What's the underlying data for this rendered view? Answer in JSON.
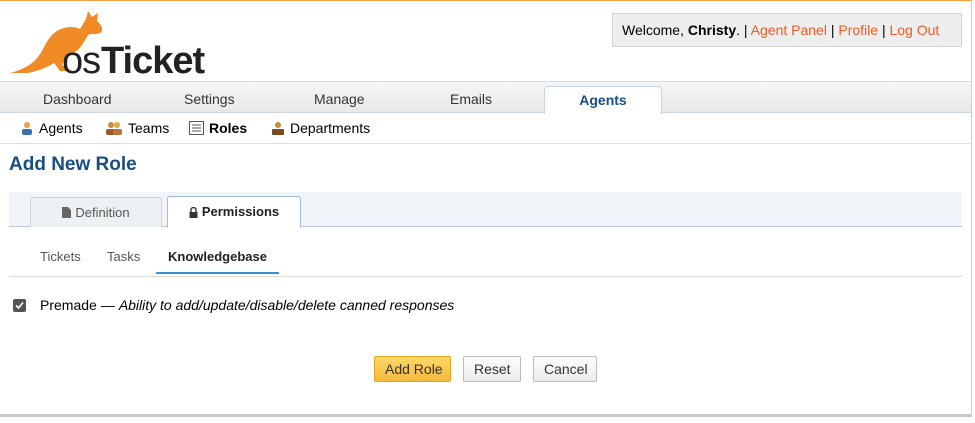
{
  "brand": {
    "logo_text_prefix": "os",
    "logo_text_main": "Ticket",
    "logo_color": "#f05a24"
  },
  "welcome": {
    "greeting": "Welcome,",
    "user": "Christy",
    "suffix": ".",
    "sep": "|",
    "links": [
      "Agent Panel",
      "Profile",
      "Log Out"
    ]
  },
  "nav": {
    "tabs": [
      "Dashboard",
      "Settings",
      "Manage",
      "Emails",
      "Agents"
    ],
    "active": "Agents"
  },
  "subnav": {
    "items": [
      {
        "label": "Agents",
        "icon": "agent-icon"
      },
      {
        "label": "Teams",
        "icon": "teams-icon"
      },
      {
        "label": "Roles",
        "icon": "roles-icon"
      },
      {
        "label": "Departments",
        "icon": "departments-icon"
      }
    ],
    "active": "Roles"
  },
  "page": {
    "title": "Add New Role"
  },
  "tabs": {
    "items": [
      {
        "label": "Definition",
        "icon": "document-icon"
      },
      {
        "label": "Permissions",
        "icon": "lock-icon"
      }
    ],
    "active": "Permissions"
  },
  "subtabs": {
    "items": [
      "Tickets",
      "Tasks",
      "Knowledgebase"
    ],
    "active": "Knowledgebase"
  },
  "permission": {
    "name": "Premade",
    "dash": "—",
    "description": "Ability to add/update/disable/delete canned responses",
    "checked": true
  },
  "buttons": {
    "submit": "Add Role",
    "reset": "Reset",
    "cancel": "Cancel"
  },
  "colors": {
    "accent": "#184e81",
    "link": "#f05a24",
    "primary_button": "#f4b93b"
  }
}
